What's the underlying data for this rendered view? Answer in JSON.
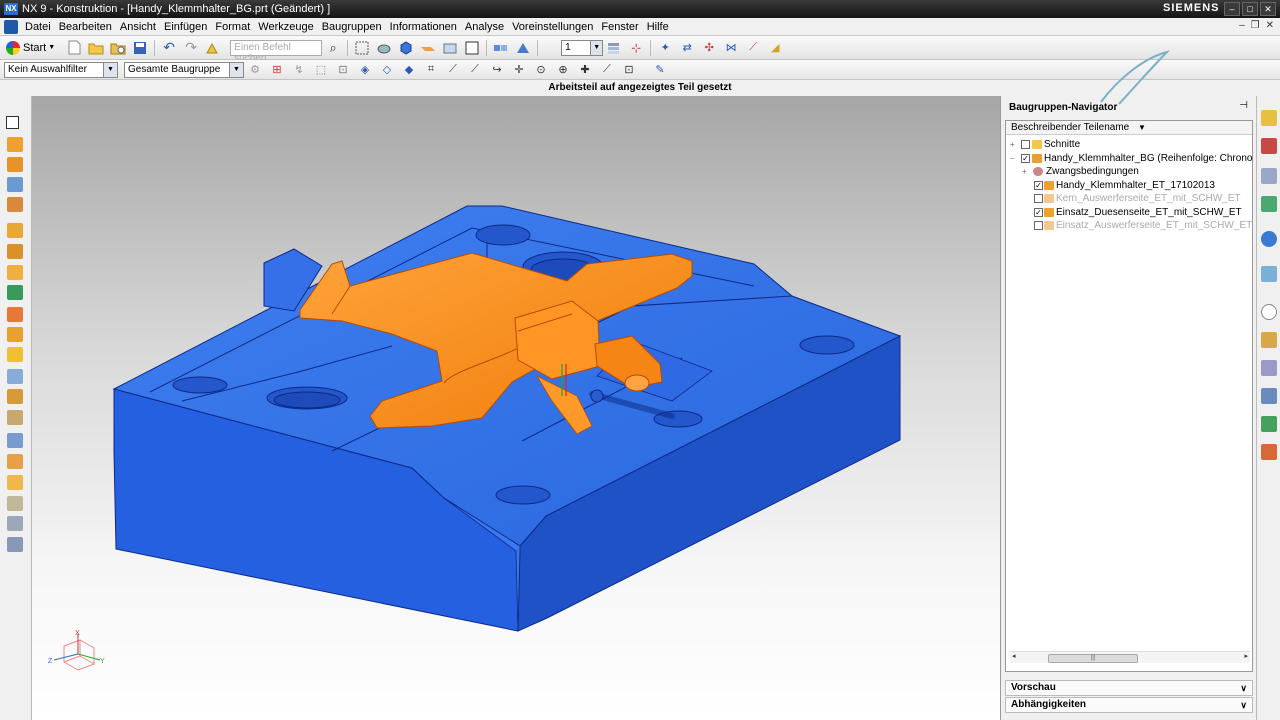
{
  "window": {
    "title": "NX 9 - Konstruktion - [Handy_Klemmhalter_BG.prt (Geändert) ]",
    "brand": "SIEMENS"
  },
  "menu": [
    "Datei",
    "Bearbeiten",
    "Ansicht",
    "Einfügen",
    "Format",
    "Werkzeuge",
    "Baugruppen",
    "Informationen",
    "Analyse",
    "Voreinstellungen",
    "Fenster",
    "Hilfe"
  ],
  "toolbar": {
    "start_label": "Start",
    "search_placeholder": "Einen Befehl suchen",
    "layer_value": "1"
  },
  "selection_bar": {
    "filter": "Kein Auswahlfilter",
    "scope": "Gesamte Baugruppe"
  },
  "status_message": "Arbeitsteil auf angezeigtes Teil gesetzt",
  "navigator": {
    "title": "Baugruppen-Navigator",
    "column_header": "Beschreibender Teilename",
    "tree": [
      {
        "label": "Schnitte",
        "level": 1,
        "checked": false,
        "expander": "+",
        "dim": false,
        "icon": "folder-icon"
      },
      {
        "label": "Handy_Klemmhalter_BG (Reihenfolge: Chronolo",
        "level": 1,
        "checked": true,
        "expander": "−",
        "dim": false,
        "icon": "assembly-icon"
      },
      {
        "label": "Zwangsbedingungen",
        "level": 2,
        "checked": null,
        "expander": "+",
        "dim": false,
        "icon": "constraints-icon"
      },
      {
        "label": "Handy_Klemmhalter_ET_17102013",
        "level": 3,
        "checked": true,
        "expander": "",
        "dim": false,
        "icon": "part-icon"
      },
      {
        "label": "Kern_Auswerferseite_ET_mit_SCHW_ET",
        "level": 3,
        "checked": false,
        "expander": "",
        "dim": true,
        "icon": "part-icon"
      },
      {
        "label": "Einsatz_Duesenseite_ET_mit_SCHW_ET",
        "level": 3,
        "checked": true,
        "expander": "",
        "dim": false,
        "icon": "part-icon"
      },
      {
        "label": "Einsatz_Auswerferseite_ET_mit_SCHW_ET",
        "level": 3,
        "checked": false,
        "expander": "",
        "dim": true,
        "icon": "part-icon"
      }
    ],
    "sections": [
      {
        "label": "Vorschau"
      },
      {
        "label": "Abhängigkeiten"
      }
    ]
  },
  "colors": {
    "mold_blue": "#2c6ce4",
    "part_orange": "#ff8a12"
  }
}
